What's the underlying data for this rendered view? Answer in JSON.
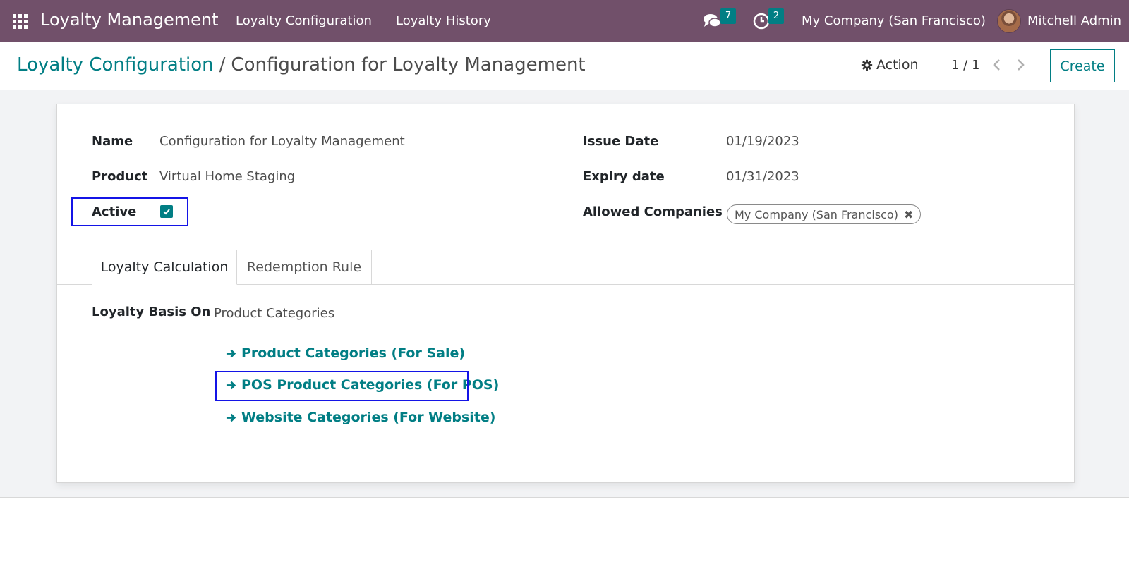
{
  "navbar": {
    "app_title": "Loyalty Management",
    "menu": [
      "Loyalty Configuration",
      "Loyalty History"
    ],
    "messages_count": "7",
    "activities_count": "2",
    "company": "My Company (San Francisco)",
    "user": "Mitchell Admin"
  },
  "control_panel": {
    "breadcrumb_parent": "Loyalty Configuration",
    "breadcrumb_separator": "/",
    "breadcrumb_current": "Configuration for Loyalty Management",
    "action_label": "Action",
    "pager": "1 / 1",
    "create_label": "Create"
  },
  "form": {
    "name_label": "Name",
    "name_value": "Configuration for Loyalty Management",
    "product_label": "Product",
    "product_value": "Virtual Home Staging",
    "active_label": "Active",
    "active_checked": true,
    "issue_date_label": "Issue Date",
    "issue_date_value": "01/19/2023",
    "expiry_date_label": "Expiry date",
    "expiry_date_value": "01/31/2023",
    "allowed_companies_label": "Allowed Companies",
    "allowed_companies_tags": [
      "My Company (San Francisco)"
    ]
  },
  "tabs": [
    "Loyalty Calculation",
    "Redemption Rule"
  ],
  "loyalty_calc": {
    "basis_label": "Loyalty Basis On",
    "basis_value": "Product Categories",
    "links": [
      "Product Categories (For Sale)",
      "POS Product Categories (For POS)",
      "Website Categories (For Website)"
    ]
  },
  "colors": {
    "navbar": "#71506a",
    "accent": "#017e84",
    "highlight": "#1414e6"
  }
}
